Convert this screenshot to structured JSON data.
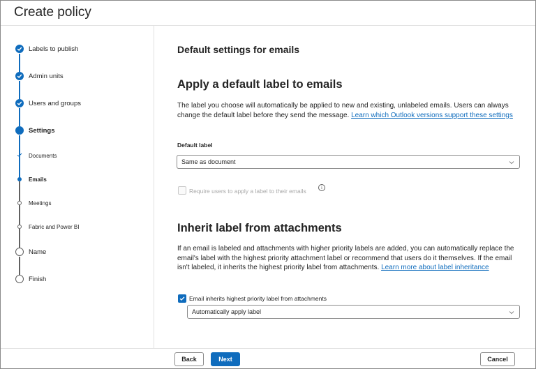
{
  "window": {
    "title": "Create policy"
  },
  "steps": [
    {
      "label": "Labels to publish",
      "state": "done"
    },
    {
      "label": "Admin units",
      "state": "done"
    },
    {
      "label": "Users and groups",
      "state": "done"
    },
    {
      "label": "Settings",
      "state": "current"
    },
    {
      "label": "Documents",
      "state": "sub-done"
    },
    {
      "label": "Emails",
      "state": "sub-current"
    },
    {
      "label": "Meetings",
      "state": "sub-todo"
    },
    {
      "label": "Fabric and Power BI",
      "state": "sub-todo"
    },
    {
      "label": "Name",
      "state": "todo"
    },
    {
      "label": "Finish",
      "state": "todo"
    }
  ],
  "main": {
    "page_heading": "Default settings for emails",
    "section1": {
      "heading": "Apply a default label to emails",
      "description": "The label you choose will automatically be applied to new and existing, unlabeled emails. Users can always change the default label before they send the message.",
      "link": "Learn which Outlook versions support these settings",
      "field_label": "Default label",
      "default_label_value": "Same as document",
      "require_checkbox_label": "Require users to apply a label to their emails",
      "require_checked": false,
      "info_glyph": "i"
    },
    "section2": {
      "heading": "Inherit label from attachments",
      "description": "If an email is labeled and attachments with higher priority labels are added, you can automatically replace the email's label with the highest priority attachment label or recommend that users do it themselves. If the email isn't labeled, it inherits the highest priority label from attachments.",
      "link": "Learn more about label inheritance",
      "inherit_checkbox_label": "Email inherits highest priority label from attachments",
      "inherit_checked": true,
      "inherit_mode_value": "Automatically apply label"
    }
  },
  "footer": {
    "back_label": "Back",
    "next_label": "Next",
    "cancel_label": "Cancel"
  },
  "colors": {
    "accent": "#0f6cbd",
    "text": "#242424",
    "border": "#8a8a8a",
    "disabled_text": "#a8a8a8"
  }
}
